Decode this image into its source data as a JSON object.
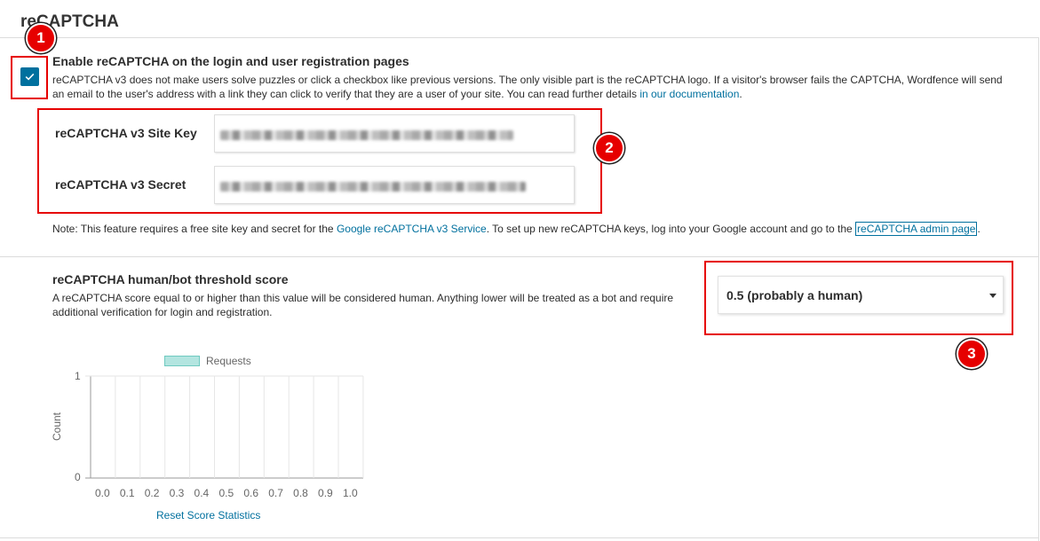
{
  "section_title": "reCAPTCHA",
  "enable": {
    "checked": true,
    "heading": "Enable reCAPTCHA on the login and user registration pages",
    "description": "reCAPTCHA v3 does not make users solve puzzles or click a checkbox like previous versions. The only visible part is the reCAPTCHA logo. If a visitor's browser fails the CAPTCHA, Wordfence will send an email to the user's address with a link they can click to verify that they are a user of your site. You can read further details ",
    "doc_link": "in our documentation",
    "desc_end": "."
  },
  "keys": {
    "site_key_label": "reCAPTCHA v3 Site Key",
    "secret_label": "reCAPTCHA v3 Secret"
  },
  "note": {
    "prefix": "Note: This feature requires a free site key and secret for the ",
    "service_link": "Google reCAPTCHA v3 Service",
    "middle": ". To set up new reCAPTCHA keys, log into your Google account and go to the ",
    "admin_link": "reCAPTCHA admin page",
    "suffix": "."
  },
  "threshold": {
    "heading": "reCAPTCHA human/bot threshold score",
    "description": "A reCAPTCHA score equal to or higher than this value will be considered human. Anything lower will be treated as a bot and require additional verification for login and registration.",
    "selected": "0.5 (probably a human)"
  },
  "callouts": [
    "1",
    "2",
    "3"
  ],
  "chart_data": {
    "type": "bar",
    "legend": "Requests",
    "categories": [
      "0.0",
      "0.1",
      "0.2",
      "0.3",
      "0.4",
      "0.5",
      "0.6",
      "0.7",
      "0.8",
      "0.9",
      "1.0"
    ],
    "series": [
      {
        "name": "Requests",
        "values": [
          0,
          0,
          0,
          0,
          0,
          0,
          0,
          0,
          0,
          0,
          0
        ]
      }
    ],
    "ylabel": "Count",
    "yticks": [
      "1",
      "0"
    ],
    "ylim": [
      0,
      1
    ],
    "grid": true,
    "colors": {
      "fill": "#b3e5e0",
      "stroke": "#6fcac0"
    }
  },
  "reset_link": "Reset Score Statistics",
  "colors": {
    "accent": "#00709e",
    "callout": "#e60000"
  }
}
